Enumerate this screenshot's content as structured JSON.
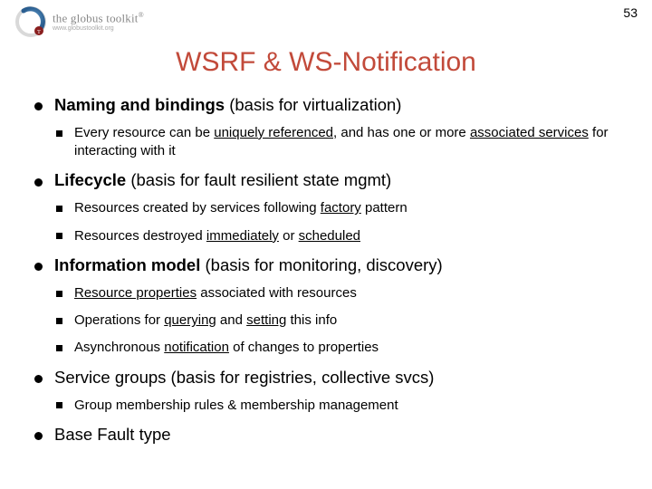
{
  "page_number": "53",
  "brand": {
    "name": "the globus toolkit",
    "reg": "®",
    "url": "www.globustoolkit.org"
  },
  "title": "WSRF & WS-Notification",
  "bullets": {
    "b1": {
      "strong": "Naming and bindings",
      "rest": " (basis for virtualization)",
      "sub": {
        "a_pre": "Every resource can be ",
        "a_u1": "uniquely referenced",
        "a_mid": ", and has one or more ",
        "a_u2": "associated services",
        "a_post": " for interacting with it"
      }
    },
    "b2": {
      "strong": "Lifecycle",
      "rest": " (basis for fault resilient state mgmt)",
      "sub": {
        "a_pre": "Resources created by services following ",
        "a_u1": "factory",
        "a_post": " pattern",
        "b_pre": "Resources destroyed ",
        "b_u1": "immediately",
        "b_mid": " or ",
        "b_u2": "scheduled"
      }
    },
    "b3": {
      "strong": "Information model",
      "rest": " (basis for monitoring, discovery)",
      "sub": {
        "a_u1": "Resource properties",
        "a_post": " associated with resources",
        "b_pre": "Operations for ",
        "b_u1": "querying",
        "b_mid": " and ",
        "b_u2": "setting",
        "b_post": " this info",
        "c_pre": "Asynchronous ",
        "c_u1": "notification",
        "c_post": " of changes to properties"
      }
    },
    "b4": {
      "text": "Service groups (basis for registries, collective svcs)",
      "sub": {
        "a": "Group membership rules & membership management"
      }
    },
    "b5": {
      "text": "Base Fault type"
    }
  }
}
